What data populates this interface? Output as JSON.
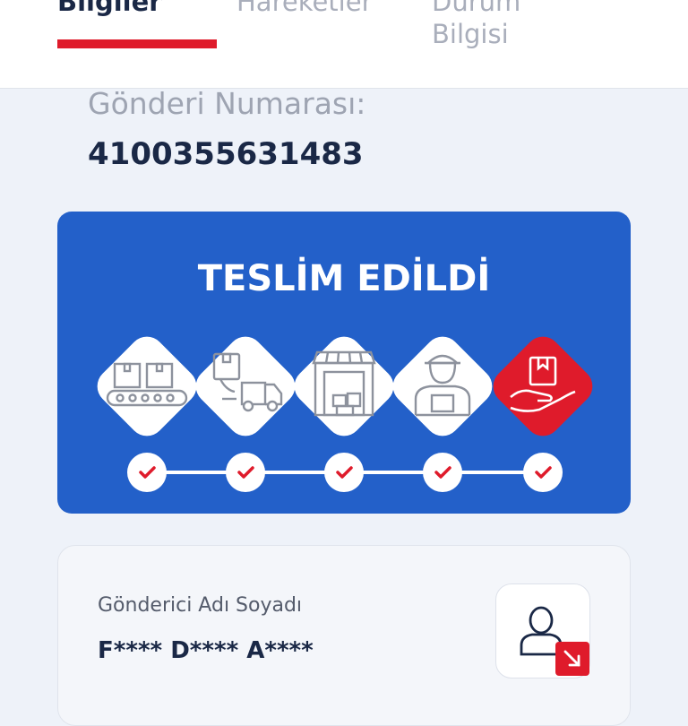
{
  "tabs": {
    "info": "Bilgiler",
    "movements": "Hareketler",
    "status_line1": "Durum",
    "status_line2": "Bilgisi"
  },
  "shipment": {
    "label": "Gönderi Numarası:",
    "number": "4100355631483"
  },
  "status": {
    "title": "TESLİM EDİLDİ",
    "steps": [
      {
        "icon": "conveyor-boxes-icon",
        "completed": true,
        "active": false
      },
      {
        "icon": "delivery-truck-icon",
        "completed": true,
        "active": false
      },
      {
        "icon": "warehouse-icon",
        "completed": true,
        "active": false
      },
      {
        "icon": "courier-icon",
        "completed": true,
        "active": false
      },
      {
        "icon": "hand-package-icon",
        "completed": true,
        "active": true
      }
    ]
  },
  "sender": {
    "label": "Gönderici Adı Soyadı",
    "name": "F**** D**** A****"
  },
  "colors": {
    "accent_red": "#df1b2b",
    "card_blue": "#2360c9",
    "text_dark": "#1a2846",
    "tab_inactive": "#a9aebb"
  }
}
